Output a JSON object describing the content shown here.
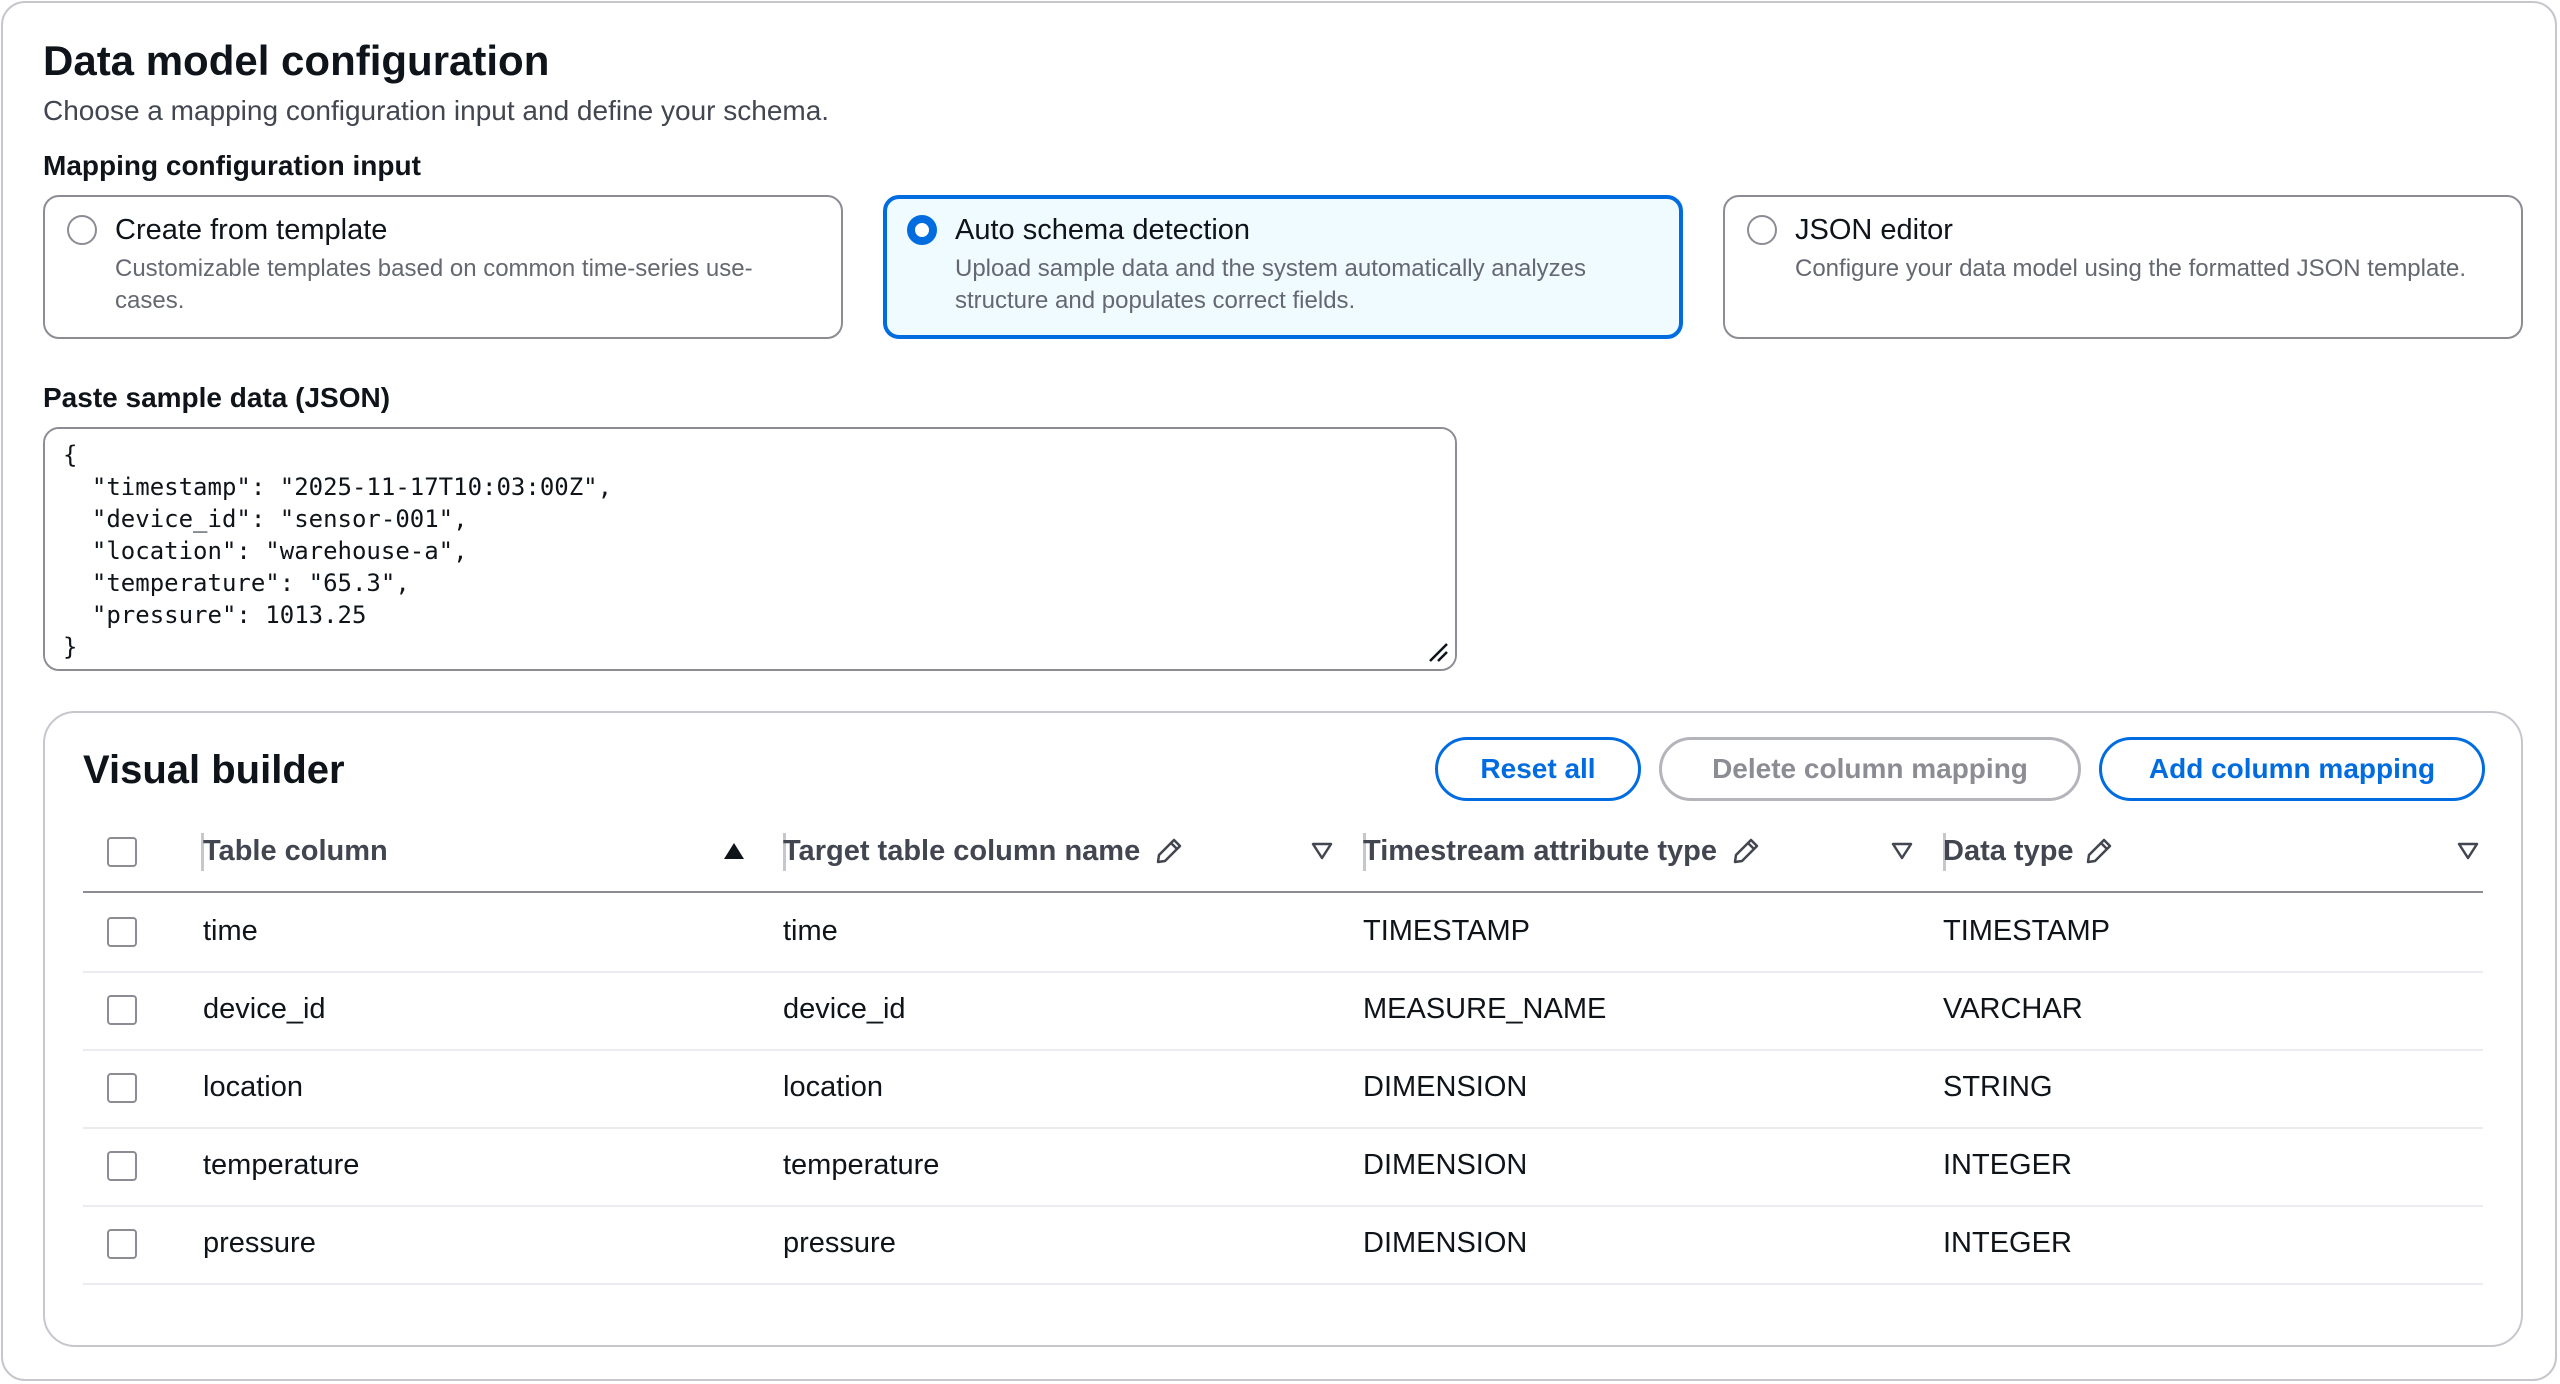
{
  "page": {
    "title": "Data model configuration",
    "description": "Choose a mapping configuration input and define your schema."
  },
  "mapping": {
    "label": "Mapping configuration input",
    "options": [
      {
        "title": "Create from template",
        "description": "Customizable templates based on common time-series use-cases.",
        "selected": false
      },
      {
        "title": "Auto schema detection",
        "description": "Upload sample data and the system automatically analyzes structure and populates correct fields.",
        "selected": true
      },
      {
        "title": "JSON editor",
        "description": "Configure your data model using the formatted JSON template.",
        "selected": false
      }
    ]
  },
  "sample": {
    "label": "Paste sample data (JSON)",
    "value": "{\n  \"timestamp\": \"2025-11-17T10:03:00Z\",\n  \"device_id\": \"sensor-001\",\n  \"location\": \"warehouse-a\",\n  \"temperature\": \"65.3\",\n  \"pressure\": 1013.25\n}"
  },
  "builder": {
    "title": "Visual builder",
    "buttons": {
      "reset": "Reset all",
      "delete": "Delete column mapping",
      "add": "Add column mapping"
    },
    "columns": {
      "table_column": "Table column",
      "target_name": "Target table column name",
      "attribute_type": "Timestream attribute type",
      "data_type": "Data type"
    },
    "rows": [
      {
        "table_column": "time",
        "target_name": "time",
        "attribute_type": "TIMESTAMP",
        "data_type": "TIMESTAMP"
      },
      {
        "table_column": "device_id",
        "target_name": "device_id",
        "attribute_type": "MEASURE_NAME",
        "data_type": "VARCHAR"
      },
      {
        "table_column": "location",
        "target_name": "location",
        "attribute_type": "DIMENSION",
        "data_type": "STRING"
      },
      {
        "table_column": "temperature",
        "target_name": "temperature",
        "attribute_type": "DIMENSION",
        "data_type": "INTEGER"
      },
      {
        "table_column": "pressure",
        "target_name": "pressure",
        "attribute_type": "DIMENSION",
        "data_type": "INTEGER"
      }
    ]
  },
  "colors": {
    "accent": "#006ce0",
    "selected_bg": "#f0fbff",
    "border": "#8c8c94",
    "disabled": "#b4b4bb"
  },
  "icons": {
    "sort_ascending": "sort-ascending-icon",
    "filter": "filter-icon",
    "edit": "pencil-icon",
    "resize": "resize-handle-icon"
  }
}
